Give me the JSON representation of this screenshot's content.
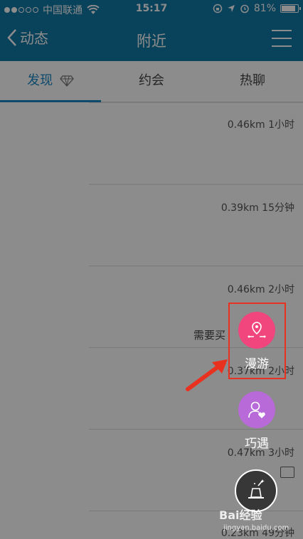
{
  "status_bar": {
    "carrier": "中国联通",
    "time": "15:17",
    "battery": "81%",
    "battery_level": 0.81
  },
  "nav": {
    "back_label": "动态",
    "title": "附近"
  },
  "tabs": [
    {
      "label": "发现",
      "active": true
    },
    {
      "label": "约会",
      "active": false
    },
    {
      "label": "热聊",
      "active": false
    }
  ],
  "feed": [
    {
      "meta": "0.46km 1小时"
    },
    {
      "meta": "0.39km 15分钟"
    },
    {
      "meta": "0.46km 2小时",
      "snippet": "需要买"
    },
    {
      "meta": "0.37km 2小时"
    },
    {
      "meta": "0.47km 3小时"
    },
    {
      "meta": "0.23km 49分钟"
    }
  ],
  "actions": {
    "roam_label": "漫游",
    "encounter_label": "巧遇"
  },
  "watermark": {
    "brand": "Bai经验",
    "url": "jingyan.baidu.com"
  },
  "colors": {
    "nav_bg": "#1279a6",
    "active_tab": "#1b87c4",
    "roam_button": "#f0457d",
    "encounter_button": "#b86ad8",
    "highlight": "#e8321f"
  }
}
